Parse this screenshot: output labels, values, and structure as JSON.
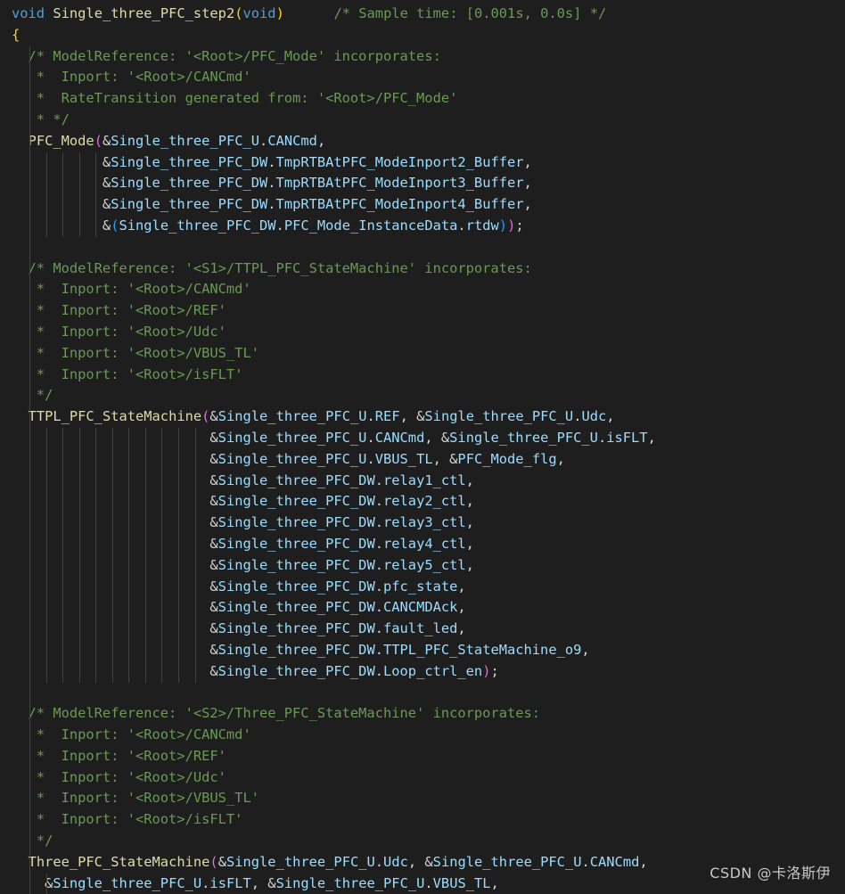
{
  "editor": {
    "language": "c",
    "theme_colors": {
      "background": "#1e1e1e",
      "keyword": "#569cd6",
      "function": "#dcdcaa",
      "comment": "#6a9955",
      "variable": "#9cdcfe",
      "text": "#d4d4d4",
      "bracket_level1": "#ffd700",
      "bracket_level2": "#da70d6",
      "bracket_level3": "#179fff"
    },
    "lines": [
      {
        "guides": 0,
        "tokens": [
          {
            "c": "kw",
            "t": "void"
          },
          {
            "c": "tx",
            "t": " "
          },
          {
            "c": "fn",
            "t": "Single_three_PFC_step2"
          },
          {
            "c": "br1",
            "t": "("
          },
          {
            "c": "kw",
            "t": "void"
          },
          {
            "c": "br1",
            "t": ")"
          },
          {
            "c": "tx",
            "t": "      "
          },
          {
            "c": "cm",
            "t": "/* Sample time: [0.001s, 0.0s] */"
          }
        ]
      },
      {
        "guides": 0,
        "tokens": [
          {
            "c": "br1",
            "t": "{"
          }
        ]
      },
      {
        "guides": 1,
        "tokens": [
          {
            "c": "cm",
            "t": "  /* ModelReference: '<Root>/PFC_Mode' incorporates:"
          }
        ]
      },
      {
        "guides": 1,
        "tokens": [
          {
            "c": "cm",
            "t": "   *  Inport: '<Root>/CANCmd'"
          }
        ]
      },
      {
        "guides": 1,
        "tokens": [
          {
            "c": "cm",
            "t": "   *  RateTransition generated from: '<Root>/PFC_Mode'"
          }
        ]
      },
      {
        "guides": 1,
        "tokens": [
          {
            "c": "cm",
            "t": "   * */"
          }
        ]
      },
      {
        "guides": 1,
        "tokens": [
          {
            "c": "tx",
            "t": "  "
          },
          {
            "c": "fn",
            "t": "PFC_Mode"
          },
          {
            "c": "br2",
            "t": "("
          },
          {
            "c": "tx",
            "t": "&"
          },
          {
            "c": "var",
            "t": "Single_three_PFC_U"
          },
          {
            "c": "tx",
            "t": "."
          },
          {
            "c": "var",
            "t": "CANCmd"
          },
          {
            "c": "tx",
            "t": ","
          }
        ]
      },
      {
        "guides": 5,
        "tokens": [
          {
            "c": "tx",
            "t": "           &"
          },
          {
            "c": "var",
            "t": "Single_three_PFC_DW"
          },
          {
            "c": "tx",
            "t": "."
          },
          {
            "c": "var",
            "t": "TmpRTBAtPFC_ModeInport2_Buffer"
          },
          {
            "c": "tx",
            "t": ","
          }
        ]
      },
      {
        "guides": 5,
        "tokens": [
          {
            "c": "tx",
            "t": "           &"
          },
          {
            "c": "var",
            "t": "Single_three_PFC_DW"
          },
          {
            "c": "tx",
            "t": "."
          },
          {
            "c": "var",
            "t": "TmpRTBAtPFC_ModeInport3_Buffer"
          },
          {
            "c": "tx",
            "t": ","
          }
        ]
      },
      {
        "guides": 5,
        "tokens": [
          {
            "c": "tx",
            "t": "           &"
          },
          {
            "c": "var",
            "t": "Single_three_PFC_DW"
          },
          {
            "c": "tx",
            "t": "."
          },
          {
            "c": "var",
            "t": "TmpRTBAtPFC_ModeInport4_Buffer"
          },
          {
            "c": "tx",
            "t": ","
          }
        ]
      },
      {
        "guides": 5,
        "tokens": [
          {
            "c": "tx",
            "t": "           &"
          },
          {
            "c": "br3",
            "t": "("
          },
          {
            "c": "var",
            "t": "Single_three_PFC_DW"
          },
          {
            "c": "tx",
            "t": "."
          },
          {
            "c": "var",
            "t": "PFC_Mode_InstanceData"
          },
          {
            "c": "tx",
            "t": "."
          },
          {
            "c": "var",
            "t": "rtdw"
          },
          {
            "c": "br3",
            "t": ")"
          },
          {
            "c": "br2",
            "t": ")"
          },
          {
            "c": "tx",
            "t": ";"
          }
        ]
      },
      {
        "guides": 1,
        "tokens": [
          {
            "c": "tx",
            "t": ""
          }
        ]
      },
      {
        "guides": 1,
        "tokens": [
          {
            "c": "cm",
            "t": "  /* ModelReference: '<S1>/TTPL_PFC_StateMachine' incorporates:"
          }
        ]
      },
      {
        "guides": 1,
        "tokens": [
          {
            "c": "cm",
            "t": "   *  Inport: '<Root>/CANCmd'"
          }
        ]
      },
      {
        "guides": 1,
        "tokens": [
          {
            "c": "cm",
            "t": "   *  Inport: '<Root>/REF'"
          }
        ]
      },
      {
        "guides": 1,
        "tokens": [
          {
            "c": "cm",
            "t": "   *  Inport: '<Root>/Udc'"
          }
        ]
      },
      {
        "guides": 1,
        "tokens": [
          {
            "c": "cm",
            "t": "   *  Inport: '<Root>/VBUS_TL'"
          }
        ]
      },
      {
        "guides": 1,
        "tokens": [
          {
            "c": "cm",
            "t": "   *  Inport: '<Root>/isFLT'"
          }
        ]
      },
      {
        "guides": 1,
        "tokens": [
          {
            "c": "cm",
            "t": "   */"
          }
        ]
      },
      {
        "guides": 1,
        "tokens": [
          {
            "c": "tx",
            "t": "  "
          },
          {
            "c": "fn",
            "t": "TTPL_PFC_StateMachine"
          },
          {
            "c": "br2",
            "t": "("
          },
          {
            "c": "tx",
            "t": "&"
          },
          {
            "c": "var",
            "t": "Single_three_PFC_U"
          },
          {
            "c": "tx",
            "t": "."
          },
          {
            "c": "var",
            "t": "REF"
          },
          {
            "c": "tx",
            "t": ", &"
          },
          {
            "c": "var",
            "t": "Single_three_PFC_U"
          },
          {
            "c": "tx",
            "t": "."
          },
          {
            "c": "var",
            "t": "Udc"
          },
          {
            "c": "tx",
            "t": ","
          }
        ]
      },
      {
        "guides": 11,
        "tokens": [
          {
            "c": "tx",
            "t": "                        &"
          },
          {
            "c": "var",
            "t": "Single_three_PFC_U"
          },
          {
            "c": "tx",
            "t": "."
          },
          {
            "c": "var",
            "t": "CANCmd"
          },
          {
            "c": "tx",
            "t": ", &"
          },
          {
            "c": "var",
            "t": "Single_three_PFC_U"
          },
          {
            "c": "tx",
            "t": "."
          },
          {
            "c": "var",
            "t": "isFLT"
          },
          {
            "c": "tx",
            "t": ","
          }
        ]
      },
      {
        "guides": 11,
        "tokens": [
          {
            "c": "tx",
            "t": "                        &"
          },
          {
            "c": "var",
            "t": "Single_three_PFC_U"
          },
          {
            "c": "tx",
            "t": "."
          },
          {
            "c": "var",
            "t": "VBUS_TL"
          },
          {
            "c": "tx",
            "t": ", &"
          },
          {
            "c": "var",
            "t": "PFC_Mode_flg"
          },
          {
            "c": "tx",
            "t": ","
          }
        ]
      },
      {
        "guides": 11,
        "tokens": [
          {
            "c": "tx",
            "t": "                        &"
          },
          {
            "c": "var",
            "t": "Single_three_PFC_DW"
          },
          {
            "c": "tx",
            "t": "."
          },
          {
            "c": "var",
            "t": "relay1_ctl"
          },
          {
            "c": "tx",
            "t": ","
          }
        ]
      },
      {
        "guides": 11,
        "tokens": [
          {
            "c": "tx",
            "t": "                        &"
          },
          {
            "c": "var",
            "t": "Single_three_PFC_DW"
          },
          {
            "c": "tx",
            "t": "."
          },
          {
            "c": "var",
            "t": "relay2_ctl"
          },
          {
            "c": "tx",
            "t": ","
          }
        ]
      },
      {
        "guides": 11,
        "tokens": [
          {
            "c": "tx",
            "t": "                        &"
          },
          {
            "c": "var",
            "t": "Single_three_PFC_DW"
          },
          {
            "c": "tx",
            "t": "."
          },
          {
            "c": "var",
            "t": "relay3_ctl"
          },
          {
            "c": "tx",
            "t": ","
          }
        ]
      },
      {
        "guides": 11,
        "tokens": [
          {
            "c": "tx",
            "t": "                        &"
          },
          {
            "c": "var",
            "t": "Single_three_PFC_DW"
          },
          {
            "c": "tx",
            "t": "."
          },
          {
            "c": "var",
            "t": "relay4_ctl"
          },
          {
            "c": "tx",
            "t": ","
          }
        ]
      },
      {
        "guides": 11,
        "tokens": [
          {
            "c": "tx",
            "t": "                        &"
          },
          {
            "c": "var",
            "t": "Single_three_PFC_DW"
          },
          {
            "c": "tx",
            "t": "."
          },
          {
            "c": "var",
            "t": "relay5_ctl"
          },
          {
            "c": "tx",
            "t": ","
          }
        ]
      },
      {
        "guides": 11,
        "tokens": [
          {
            "c": "tx",
            "t": "                        &"
          },
          {
            "c": "var",
            "t": "Single_three_PFC_DW"
          },
          {
            "c": "tx",
            "t": "."
          },
          {
            "c": "var",
            "t": "pfc_state"
          },
          {
            "c": "tx",
            "t": ","
          }
        ]
      },
      {
        "guides": 11,
        "tokens": [
          {
            "c": "tx",
            "t": "                        &"
          },
          {
            "c": "var",
            "t": "Single_three_PFC_DW"
          },
          {
            "c": "tx",
            "t": "."
          },
          {
            "c": "var",
            "t": "CANCMDAck"
          },
          {
            "c": "tx",
            "t": ","
          }
        ]
      },
      {
        "guides": 11,
        "tokens": [
          {
            "c": "tx",
            "t": "                        &"
          },
          {
            "c": "var",
            "t": "Single_three_PFC_DW"
          },
          {
            "c": "tx",
            "t": "."
          },
          {
            "c": "var",
            "t": "fault_led"
          },
          {
            "c": "tx",
            "t": ","
          }
        ]
      },
      {
        "guides": 11,
        "tokens": [
          {
            "c": "tx",
            "t": "                        &"
          },
          {
            "c": "var",
            "t": "Single_three_PFC_DW"
          },
          {
            "c": "tx",
            "t": "."
          },
          {
            "c": "var",
            "t": "TTPL_PFC_StateMachine_o9"
          },
          {
            "c": "tx",
            "t": ","
          }
        ]
      },
      {
        "guides": 11,
        "tokens": [
          {
            "c": "tx",
            "t": "                        &"
          },
          {
            "c": "var",
            "t": "Single_three_PFC_DW"
          },
          {
            "c": "tx",
            "t": "."
          },
          {
            "c": "var",
            "t": "Loop_ctrl_en"
          },
          {
            "c": "br2",
            "t": ")"
          },
          {
            "c": "tx",
            "t": ";"
          }
        ]
      },
      {
        "guides": 1,
        "tokens": [
          {
            "c": "tx",
            "t": ""
          }
        ]
      },
      {
        "guides": 1,
        "tokens": [
          {
            "c": "cm",
            "t": "  /* ModelReference: '<S2>/Three_PFC_StateMachine' incorporates:"
          }
        ]
      },
      {
        "guides": 1,
        "tokens": [
          {
            "c": "cm",
            "t": "   *  Inport: '<Root>/CANCmd'"
          }
        ]
      },
      {
        "guides": 1,
        "tokens": [
          {
            "c": "cm",
            "t": "   *  Inport: '<Root>/REF'"
          }
        ]
      },
      {
        "guides": 1,
        "tokens": [
          {
            "c": "cm",
            "t": "   *  Inport: '<Root>/Udc'"
          }
        ]
      },
      {
        "guides": 1,
        "tokens": [
          {
            "c": "cm",
            "t": "   *  Inport: '<Root>/VBUS_TL'"
          }
        ]
      },
      {
        "guides": 1,
        "tokens": [
          {
            "c": "cm",
            "t": "   *  Inport: '<Root>/isFLT'"
          }
        ]
      },
      {
        "guides": 1,
        "tokens": [
          {
            "c": "cm",
            "t": "   */"
          }
        ]
      },
      {
        "guides": 1,
        "tokens": [
          {
            "c": "tx",
            "t": "  "
          },
          {
            "c": "fn",
            "t": "Three_PFC_StateMachine"
          },
          {
            "c": "br2",
            "t": "("
          },
          {
            "c": "tx",
            "t": "&"
          },
          {
            "c": "var",
            "t": "Single_three_PFC_U"
          },
          {
            "c": "tx",
            "t": "."
          },
          {
            "c": "var",
            "t": "Udc"
          },
          {
            "c": "tx",
            "t": ", &"
          },
          {
            "c": "var",
            "t": "Single_three_PFC_U"
          },
          {
            "c": "tx",
            "t": "."
          },
          {
            "c": "var",
            "t": "CANCmd"
          },
          {
            "c": "tx",
            "t": ","
          }
        ]
      },
      {
        "guides": 2,
        "tokens": [
          {
            "c": "tx",
            "t": "    &"
          },
          {
            "c": "var",
            "t": "Single_three_PFC_U"
          },
          {
            "c": "tx",
            "t": "."
          },
          {
            "c": "var",
            "t": "isFLT"
          },
          {
            "c": "tx",
            "t": ", &"
          },
          {
            "c": "var",
            "t": "Single_three_PFC_U"
          },
          {
            "c": "tx",
            "t": "."
          },
          {
            "c": "var",
            "t": "VBUS_TL"
          },
          {
            "c": "tx",
            "t": ","
          }
        ]
      }
    ]
  },
  "watermark": {
    "text": "CSDN @卡洛斯伊"
  }
}
